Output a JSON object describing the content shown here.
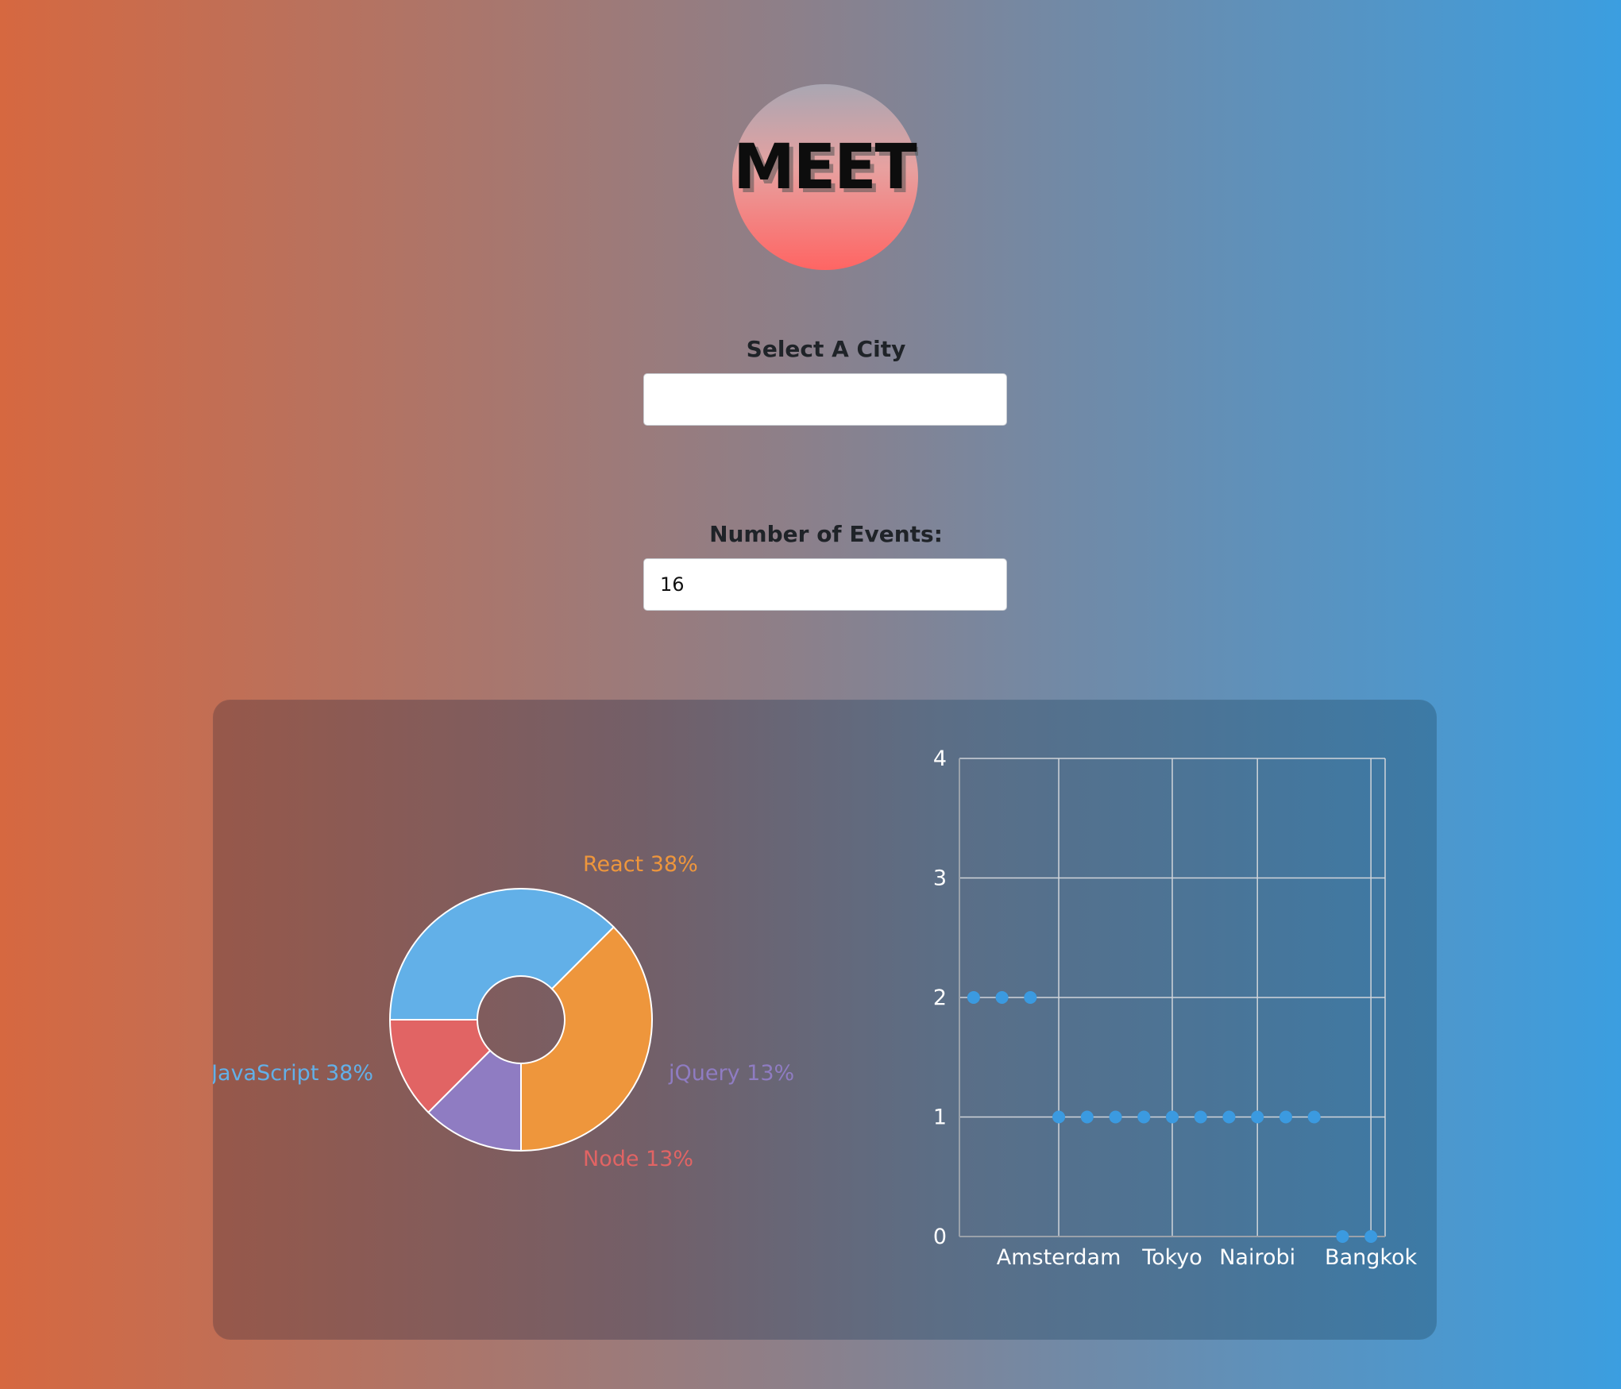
{
  "app": {
    "logo_text": "MEET"
  },
  "city_search": {
    "label": "Select A City",
    "value": "",
    "placeholder": ""
  },
  "event_count": {
    "label": "Number of Events:",
    "value": "16"
  },
  "chart_data": [
    {
      "type": "pie",
      "variant": "donut",
      "slices": [
        {
          "label": "React",
          "percent_label": "38%",
          "value": 37.5,
          "color": "#ee963c"
        },
        {
          "label": "jQuery",
          "percent_label": "13%",
          "value": 12.5,
          "color": "#8f7cc2"
        },
        {
          "label": "Node",
          "percent_label": "13%",
          "value": 12.5,
          "color": "#e16464"
        },
        {
          "label": "JavaScript",
          "percent_label": "38%",
          "value": 37.5,
          "color": "#62b0e8"
        }
      ]
    },
    {
      "type": "scatter",
      "ylim": [
        0,
        4
      ],
      "yticks": [
        0,
        1,
        2,
        3,
        4
      ],
      "xtick_labels": [
        "Amsterdam",
        "Tokyo",
        "Nairobi",
        "Bangkok"
      ],
      "point_color": "#3b9ae0",
      "grid": true,
      "x_index_range": [
        -0.5,
        14.5
      ],
      "xtick_indices": [
        3,
        7,
        10,
        14
      ],
      "points": [
        {
          "x": 0,
          "y": 2
        },
        {
          "x": 1,
          "y": 2
        },
        {
          "x": 2,
          "y": 2
        },
        {
          "x": 3,
          "y": 1
        },
        {
          "x": 4,
          "y": 1
        },
        {
          "x": 5,
          "y": 1
        },
        {
          "x": 6,
          "y": 1
        },
        {
          "x": 7,
          "y": 1
        },
        {
          "x": 8,
          "y": 1
        },
        {
          "x": 9,
          "y": 1
        },
        {
          "x": 10,
          "y": 1
        },
        {
          "x": 11,
          "y": 1
        },
        {
          "x": 12,
          "y": 1
        },
        {
          "x": 13,
          "y": 0
        },
        {
          "x": 14,
          "y": 0
        }
      ]
    }
  ]
}
